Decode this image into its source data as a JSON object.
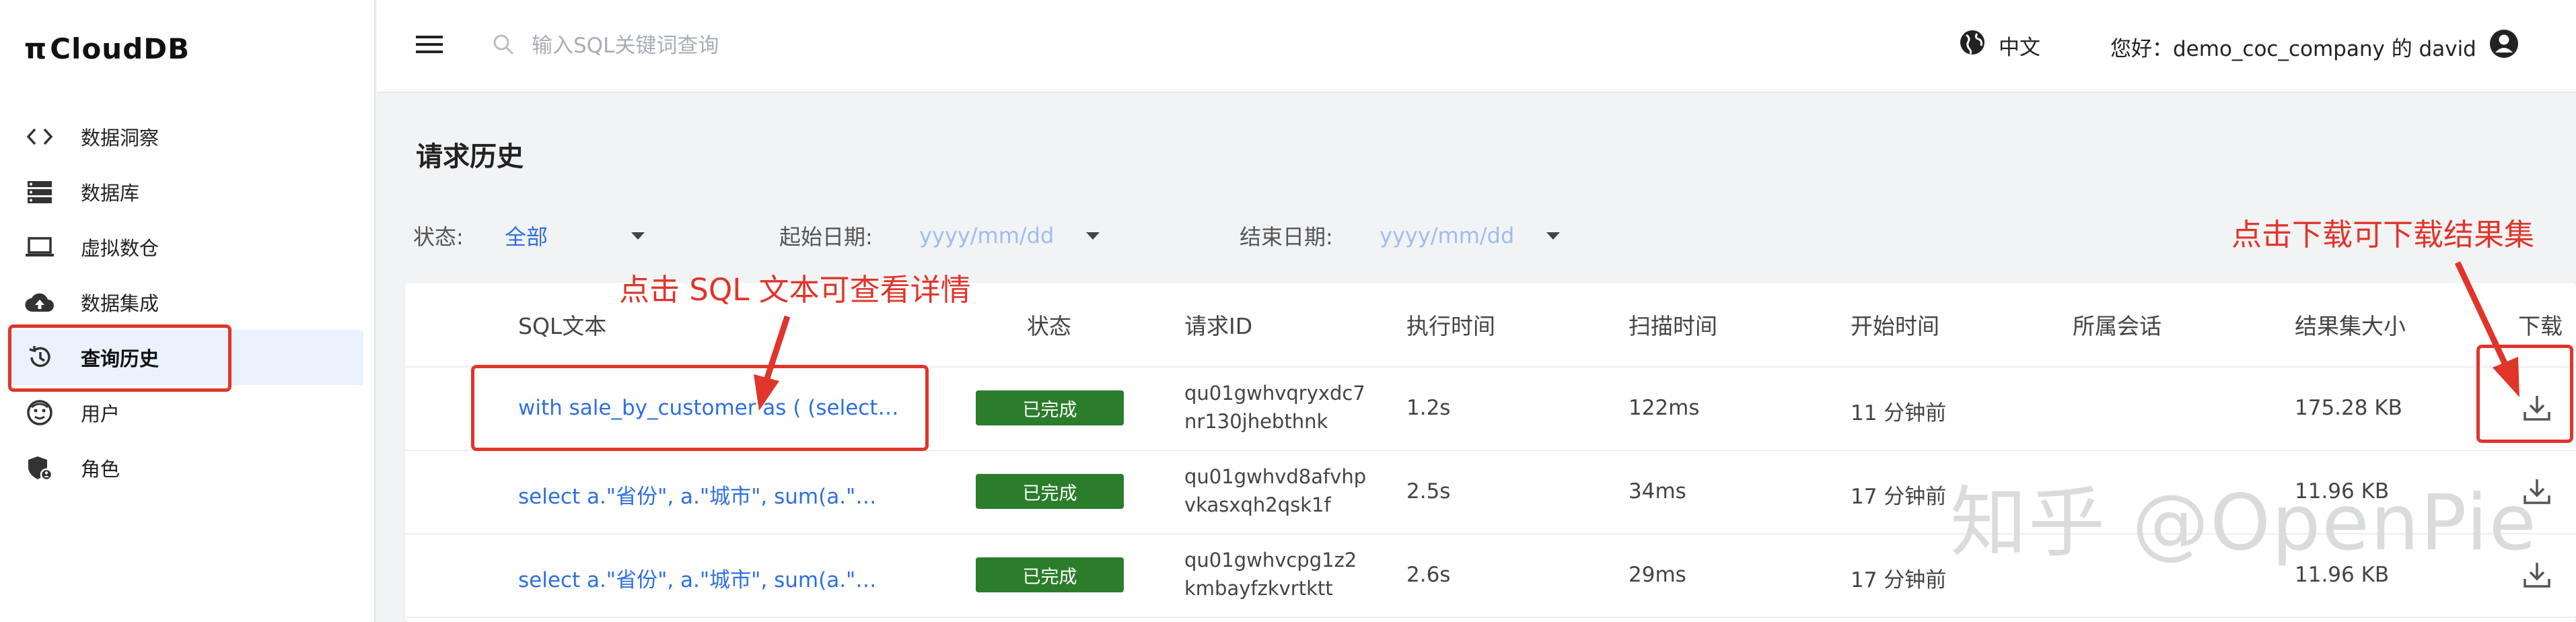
{
  "app": {
    "logo_text": "CloudDB",
    "logo_prefix": "π"
  },
  "sidebar": {
    "items": [
      {
        "label": "数据洞察",
        "icon": "code-icon"
      },
      {
        "label": "数据库",
        "icon": "database-icon"
      },
      {
        "label": "虚拟数仓",
        "icon": "laptop-icon"
      },
      {
        "label": "数据集成",
        "icon": "cloud-upload-icon"
      },
      {
        "label": "查询历史",
        "icon": "history-icon",
        "active": true
      },
      {
        "label": "用户",
        "icon": "user-icon"
      },
      {
        "label": "角色",
        "icon": "role-icon"
      }
    ]
  },
  "topbar": {
    "search_placeholder": "输入SQL关键词查询",
    "language": "中文",
    "greeting": "您好：demo_coc_company 的 david"
  },
  "page": {
    "title": "请求历史"
  },
  "filters": {
    "status_label": "状态:",
    "status_value": "全部",
    "start_label": "起始日期:",
    "start_placeholder": "yyyy/mm/dd",
    "end_label": "结束日期:",
    "end_placeholder": "yyyy/mm/dd"
  },
  "table": {
    "columns": [
      "SQL文本",
      "状态",
      "请求ID",
      "执行时间",
      "扫描时间",
      "开始时间",
      "所属会话",
      "结果集大小",
      "下载"
    ],
    "rows": [
      {
        "sql": "with sale_by_customer as ( (select…",
        "status": "已完成",
        "req_line1": "qu01gwhvqryxdc7",
        "req_line2": "nr130jhebthnk",
        "exec": "1.2s",
        "scan": "122ms",
        "start": "11 分钟前",
        "session": "",
        "size": "175.28 KB"
      },
      {
        "sql": "select a.\"省份\", a.\"城市\", sum(a.\"…",
        "status": "已完成",
        "req_line1": "qu01gwhvd8afvhp",
        "req_line2": "vkasxqh2qsk1f",
        "exec": "2.5s",
        "scan": "34ms",
        "start": "17 分钟前",
        "session": "",
        "size": "11.96 KB"
      },
      {
        "sql": "select a.\"省份\", a.\"城市\", sum(a.\"…",
        "status": "已完成",
        "req_line1": "qu01gwhvcpg1z2",
        "req_line2": "kmbayfzkvrtktt",
        "exec": "2.6s",
        "scan": "29ms",
        "start": "17 分钟前",
        "session": "",
        "size": "11.96 KB"
      }
    ]
  },
  "annotations": {
    "sql_hint": "点击 SQL 文本可查看详情",
    "download_hint": "点击下载可下载结果集"
  },
  "watermark": "知乎 @OpenPie",
  "colors": {
    "accent": "#2f6fdd",
    "success": "#2b7d2b",
    "annotation": "#e0352b",
    "active_bg": "#eaf2fd"
  }
}
